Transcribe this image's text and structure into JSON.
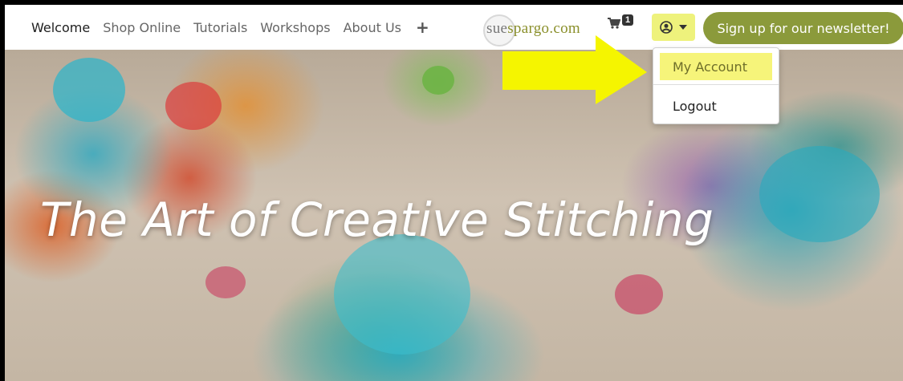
{
  "nav": {
    "links": [
      "Welcome",
      "Shop Online",
      "Tutorials",
      "Workshops",
      "About Us"
    ],
    "plus_glyph": "+"
  },
  "logo": {
    "part1": "sue",
    "part2": "spargo.com"
  },
  "cart": {
    "icon": "cart-icon",
    "count": "1"
  },
  "account": {
    "icon": "user-circle-icon",
    "accent": "#eef27c"
  },
  "newsletter": {
    "label": "Sign up for our newsletter!",
    "color": "#8b9a3b"
  },
  "dropdown": {
    "items": [
      "My Account",
      "Logout"
    ],
    "highlight_color": "#f6f47a"
  },
  "annotation": {
    "arrow_color": "#f5f500"
  },
  "hero": {
    "title": "The Art of Creative Stitching"
  }
}
